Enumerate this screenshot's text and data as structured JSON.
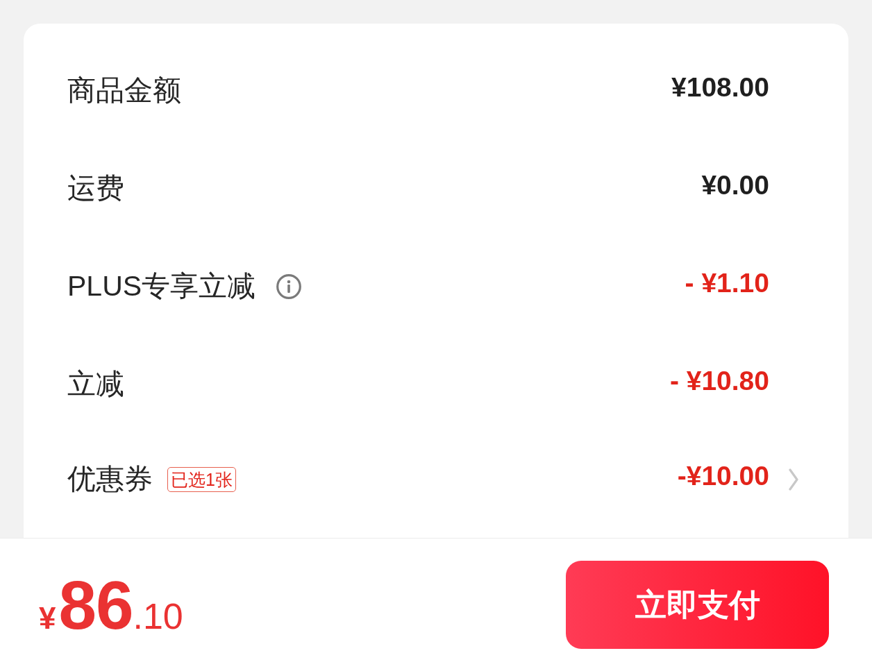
{
  "summary": {
    "rows": [
      {
        "kind": "amount",
        "label": "商品金额",
        "value": "¥108.00",
        "discount": false
      },
      {
        "kind": "amount",
        "label": "运费",
        "value": "¥0.00",
        "discount": false
      },
      {
        "kind": "info",
        "label": "PLUS专享立减",
        "value": "- ¥1.10",
        "discount": true
      },
      {
        "kind": "amount",
        "label": "立减",
        "value": "- ¥10.80",
        "discount": true
      },
      {
        "kind": "link",
        "label": "优惠券",
        "badge": "已选1张",
        "value": "-¥10.00",
        "discount": true
      }
    ]
  },
  "footer": {
    "total": {
      "currency": "¥",
      "integer": "86",
      "decimal": ".10"
    },
    "pay_button": "立即支付"
  }
}
